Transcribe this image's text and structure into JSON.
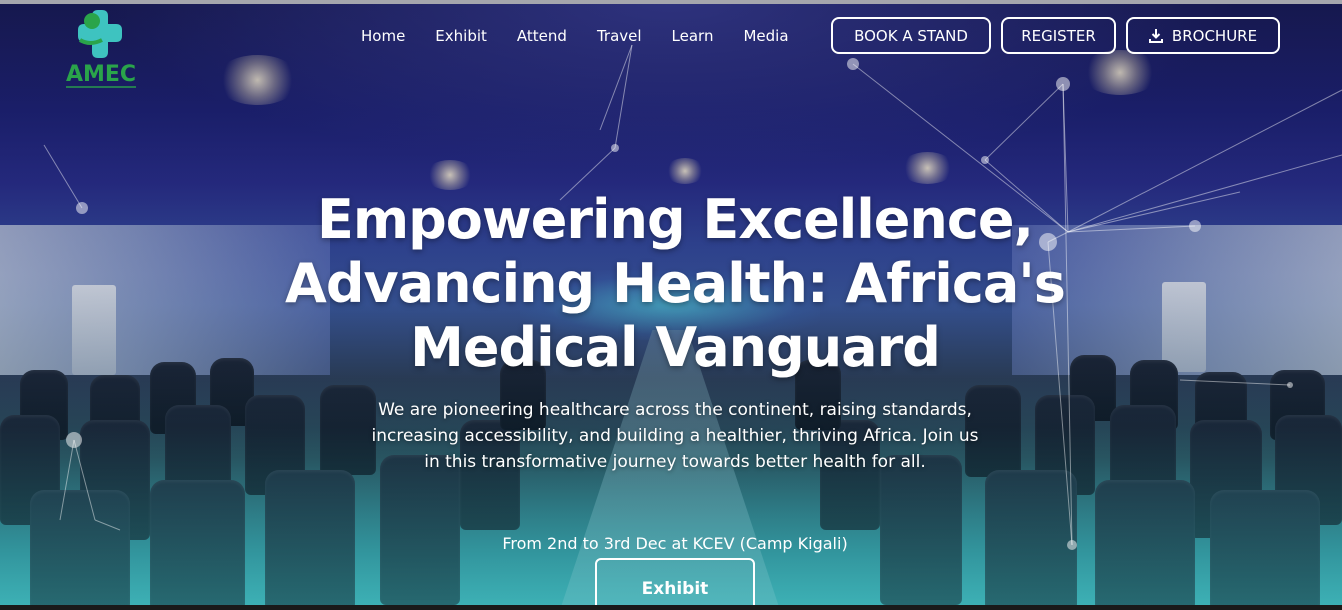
{
  "header": {
    "logo_text": "AMEC",
    "nav": [
      {
        "label": "Home"
      },
      {
        "label": "Exhibit"
      },
      {
        "label": "Attend"
      },
      {
        "label": "Travel"
      },
      {
        "label": "Learn"
      },
      {
        "label": "Media"
      }
    ],
    "buttons": {
      "book_stand": "BOOK A STAND",
      "register": "REGISTER",
      "brochure": "BROCHURE",
      "brochure_icon": "download-icon"
    }
  },
  "hero": {
    "headline_line1": "Empowering Excellence,",
    "headline_line2": "Advancing Health: Africa's",
    "headline_line3": "Medical Vanguard",
    "description": "We are pioneering healthcare across the continent, raising standards, increasing accessibility, and building a healthier, thriving Africa. Join us in this transformative journey towards better health for all.",
    "event_info": "From 2nd to 3rd Dec at KCEV (Camp Kigali)",
    "cta_label": "Exhibit"
  },
  "colors": {
    "logo_green": "#2aa44a",
    "logo_teal": "#3ec3c0",
    "text": "#ffffff",
    "button_border": "#ffffff"
  }
}
